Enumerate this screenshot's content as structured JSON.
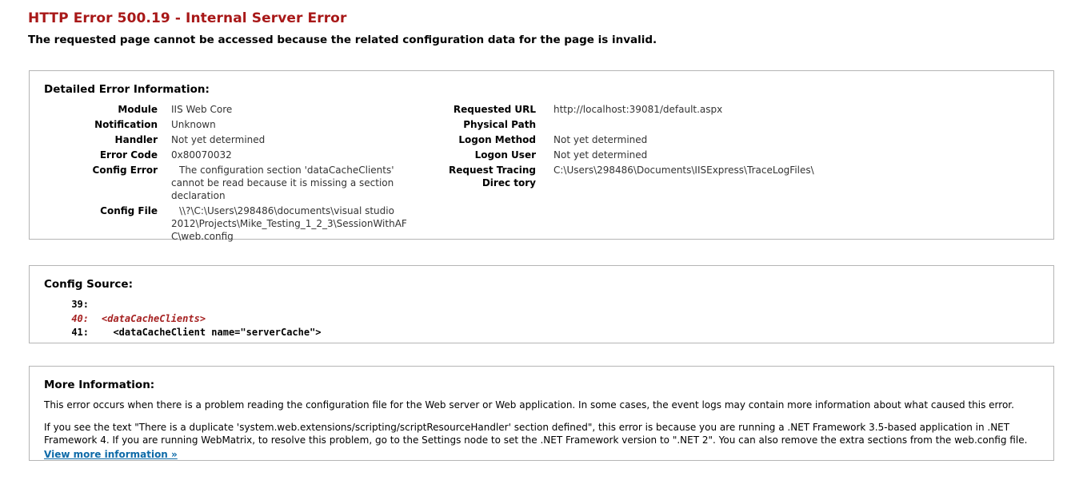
{
  "header": {
    "title": "HTTP Error 500.19 - Internal Server Error",
    "subtitle": "The requested page cannot be accessed because the related configuration data for the page is invalid.",
    "title_color": "#a81818"
  },
  "details_panel": {
    "heading": "Detailed Error Information:",
    "left_rows": [
      {
        "label": "Module",
        "value": "IIS Web Core"
      },
      {
        "label": "Notification",
        "value": "Unknown"
      },
      {
        "label": "Handler",
        "value": "Not yet determined"
      },
      {
        "label": "Error Code",
        "value": "0x80070032"
      },
      {
        "label": "Config Error",
        "value": "The configuration section 'dataCacheClients' cannot be read because it is missing a section declaration"
      },
      {
        "label": "Config File",
        "value": "\\\\?\\C:\\Users\\298486\\documents\\visual studio 2012\\Projects\\Mike_Testing_1_2_3\\SessionWithAFC\\web.config"
      }
    ],
    "right_rows": [
      {
        "label": "Requested URL",
        "value": "http://localhost:39081/default.aspx"
      },
      {
        "label": "Physical Path",
        "value": ""
      },
      {
        "label": "Logon Method",
        "value": "Not yet determined"
      },
      {
        "label": "Logon User",
        "value": "Not yet determined"
      },
      {
        "label": "Request Tracing Direc tory",
        "value": "C:\\Users\\298486\\Documents\\IISExpress\\TraceLogFiles\\"
      }
    ]
  },
  "config_panel": {
    "heading": "Config Source:",
    "lines": [
      {
        "number": "39:",
        "text": "",
        "highlight": false
      },
      {
        "number": "40:",
        "text": "<dataCacheClients>",
        "highlight": true
      },
      {
        "number": "41:",
        "text": "  <dataCacheClient name=\"serverCache\">",
        "highlight": false
      }
    ],
    "highlight_color": "#a52020"
  },
  "more_panel": {
    "heading": "More Information:",
    "paragraph_1": "This error occurs when there is a problem reading the configuration file for the Web server or Web application. In some cases, the event logs may contain more information about what caused this error.",
    "paragraph_2": "If you see the text \"There is a duplicate 'system.web.extensions/scripting/scriptResourceHandler' section defined\", this error is because you are running a .NET Framework 3.5-based application in .NET Framework 4. If you are running WebMatrix, to resolve this problem, go to the Settings node to set the .NET Framework version to \".NET 2\". You can also remove the extra sections from the web.config file.",
    "link_label": "View more information »",
    "link_color": "#0d6aa8"
  }
}
